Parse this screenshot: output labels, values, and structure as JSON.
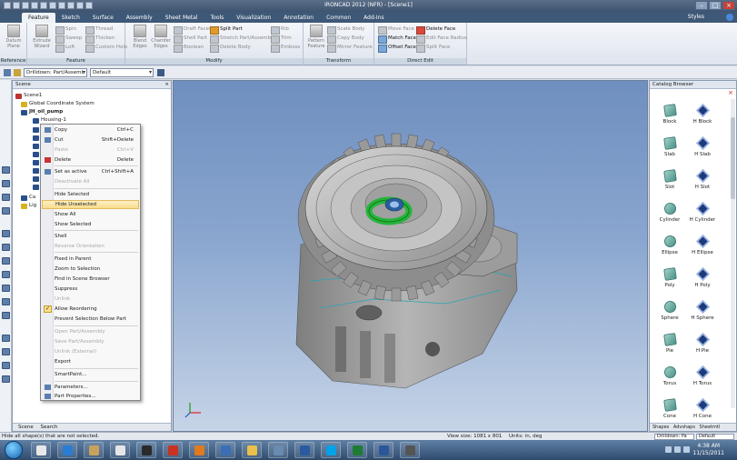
{
  "window": {
    "title": "IRONCAD 2012 (NFR) - [Scene1]",
    "min_glyph": "–",
    "max_glyph": "□",
    "close_glyph": "×"
  },
  "ribbon": {
    "tabs": [
      "Feature",
      "Sketch",
      "Surface",
      "Assembly",
      "Sheet Metal",
      "Tools",
      "Visualization",
      "Annotation",
      "Common",
      "Add-Ins"
    ],
    "active_tab": "Feature",
    "styles_label": "Styles",
    "groups": {
      "reference": "Reference",
      "feature": "Feature",
      "modify": "Modify",
      "transform": "Transform",
      "direct_edit": "Direct Edit"
    },
    "buttons": {
      "datum_plane": "Datum Plane",
      "extrude_wizard": "Extrude Wizard",
      "spin": "Spin",
      "sweep": "Sweep",
      "loft": "Loft",
      "thread": "Thread",
      "thicken": "Thicken",
      "custom_hole": "Custom Hole",
      "blend_edges": "Blend Edges",
      "chamfer_edges": "Chamfer Edges",
      "draft_faces": "Draft Faces",
      "shell_part": "Shell Part",
      "boolean": "Boolean",
      "split_part": "Split Part",
      "stretch_part": "Stretch Part/Assembly",
      "delete_body": "Delete Body",
      "rib": "Rib",
      "trim": "Trim",
      "emboss": "Emboss",
      "pattern_feature": "Pattern Feature",
      "scale_body": "Scale Body",
      "copy_body": "Copy Body",
      "mirror_feature": "Mirror Feature",
      "move_face": "Move Face",
      "match_face": "Match Face",
      "offset_face": "Offset Face",
      "delete_face": "Delete Face",
      "edit_face_radius": "Edit Face Radius",
      "split_face": "Split Face"
    }
  },
  "toolbar": {
    "drilldown": "Drilldown: Part/Assemb",
    "style": "Default"
  },
  "scene": {
    "title": "Scene",
    "tree": [
      "Scene1",
      "Global Coordinate System",
      "JH_oil_pump",
      "Housing-1",
      "Ca",
      "Lig"
    ],
    "tabs": [
      "Scene",
      "Search"
    ]
  },
  "context_menu": {
    "items": [
      {
        "label": "Copy",
        "shortcut": "Ctrl+C",
        "disabled": false
      },
      {
        "label": "Cut",
        "shortcut": "Shift+Delete",
        "disabled": false
      },
      {
        "label": "Paste",
        "shortcut": "Ctrl+V",
        "disabled": true
      },
      {
        "label": "Delete",
        "shortcut": "Delete",
        "disabled": false
      },
      {
        "label": "Set as active",
        "shortcut": "Ctrl+Shift+A",
        "disabled": false
      },
      {
        "label": "Deactivate All",
        "shortcut": "",
        "disabled": true
      },
      {
        "label": "Hide Selected",
        "shortcut": "",
        "disabled": false
      },
      {
        "label": "Hide Unselected",
        "shortcut": "",
        "disabled": false,
        "highlighted": true
      },
      {
        "label": "Show All",
        "shortcut": "",
        "disabled": false
      },
      {
        "label": "Show Selected",
        "shortcut": "",
        "disabled": false
      },
      {
        "label": "Shell",
        "shortcut": "",
        "disabled": false
      },
      {
        "label": "Reverse Orientation",
        "shortcut": "",
        "disabled": true
      },
      {
        "label": "Fixed in Parent",
        "shortcut": "",
        "disabled": false
      },
      {
        "label": "Zoom to Selection",
        "shortcut": "",
        "disabled": false
      },
      {
        "label": "Find in Scene Browser",
        "shortcut": "",
        "disabled": false
      },
      {
        "label": "Suppress",
        "shortcut": "",
        "disabled": false
      },
      {
        "label": "Unlink",
        "shortcut": "",
        "disabled": true
      },
      {
        "label": "Allow Reordering",
        "shortcut": "",
        "disabled": false,
        "checked": true
      },
      {
        "label": "Prevent Selection Below Part",
        "shortcut": "",
        "disabled": false
      },
      {
        "label": "Open Part/Assembly",
        "shortcut": "",
        "disabled": true
      },
      {
        "label": "Save Part/Assembly",
        "shortcut": "",
        "disabled": true
      },
      {
        "label": "Unlink (External)",
        "shortcut": "",
        "disabled": true
      },
      {
        "label": "Export",
        "shortcut": "",
        "disabled": false
      },
      {
        "label": "SmartPaint...",
        "shortcut": "",
        "disabled": false
      },
      {
        "label": "Parameters...",
        "shortcut": "",
        "disabled": false
      },
      {
        "label": "Part Properties...",
        "shortcut": "",
        "disabled": false
      }
    ]
  },
  "catalog": {
    "title": "Catalog Browser",
    "close_glyph": "×",
    "items": [
      {
        "label": "Block",
        "style": "solid"
      },
      {
        "label": "H Block",
        "style": "hole"
      },
      {
        "label": "Slab",
        "style": "solid"
      },
      {
        "label": "H Slab",
        "style": "hole"
      },
      {
        "label": "Slot",
        "style": "solid"
      },
      {
        "label": "H Slot",
        "style": "hole"
      },
      {
        "label": "Cylinder",
        "style": "solid"
      },
      {
        "label": "H Cylinder",
        "style": "hole"
      },
      {
        "label": "Ellipse",
        "style": "solid"
      },
      {
        "label": "H Ellipse",
        "style": "hole"
      },
      {
        "label": "Poly",
        "style": "solid"
      },
      {
        "label": "H Poly",
        "style": "hole"
      },
      {
        "label": "Sphere",
        "style": "solid"
      },
      {
        "label": "H Sphere",
        "style": "hole"
      },
      {
        "label": "Pie",
        "style": "solid"
      },
      {
        "label": "H Pie",
        "style": "hole"
      },
      {
        "label": "Torus",
        "style": "solid"
      },
      {
        "label": "H Torus",
        "style": "hole"
      },
      {
        "label": "Cone",
        "style": "solid"
      },
      {
        "label": "H Cone",
        "style": "hole"
      }
    ],
    "tabs": [
      "Shapes",
      "Advshaps",
      "Sheetmtl"
    ]
  },
  "statusbar": {
    "message": "Hide all shape(s) that are not selected.",
    "view_size": "View size: 1081 x 801",
    "units": "Units: in, deg",
    "drilldown": "Drilldown: Pa",
    "style": "Default"
  },
  "taskbar": {
    "time": "4:38 AM",
    "date": "11/15/2011",
    "app_colors": [
      "#e8e8e8",
      "#2b7cd3",
      "#c8a25a",
      "#e6e6e6",
      "#2a2a2a",
      "#c8321e",
      "#e07a1e",
      "#3a6fb7",
      "#e8c04a",
      "#6a8ab0",
      "#2b5aa0",
      "#00a2e8",
      "#1e7b34",
      "#2b579a",
      "#555555"
    ]
  }
}
